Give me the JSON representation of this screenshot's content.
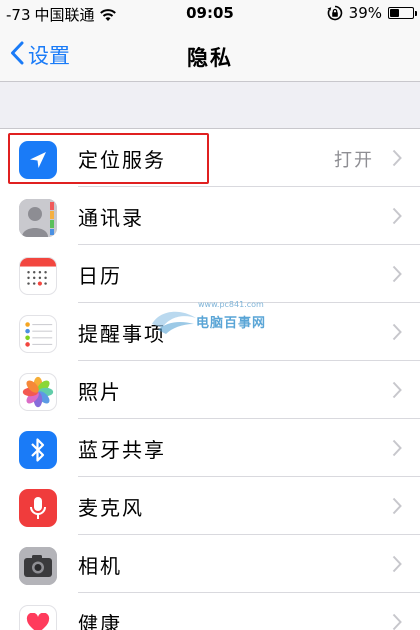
{
  "status_bar": {
    "signal": "-73",
    "carrier": "中国联通",
    "time": "09:05",
    "battery": "39%",
    "battery_level": 0.39
  },
  "nav": {
    "back_label": "设置",
    "title": "隐私"
  },
  "rows": [
    {
      "label": "定位服务",
      "value": "打开",
      "icon": "location-arrow-icon",
      "color": "#1a7bf7"
    },
    {
      "label": "通讯录",
      "value": "",
      "icon": "contacts-icon",
      "color": "#9a9a9f"
    },
    {
      "label": "日历",
      "value": "",
      "icon": "calendar-icon",
      "color": "#ffffff"
    },
    {
      "label": "提醒事项",
      "value": "",
      "icon": "reminders-icon",
      "color": "#ffffff"
    },
    {
      "label": "照片",
      "value": "",
      "icon": "photos-icon",
      "color": "#ffffff"
    },
    {
      "label": "蓝牙共享",
      "value": "",
      "icon": "bluetooth-icon",
      "color": "#1a7bf7"
    },
    {
      "label": "麦克风",
      "value": "",
      "icon": "microphone-icon",
      "color": "#f03c3c"
    },
    {
      "label": "相机",
      "value": "",
      "icon": "camera-icon",
      "color": "#9a9a9f"
    },
    {
      "label": "健康",
      "value": "",
      "icon": "health-icon",
      "color": "#ffffff"
    }
  ],
  "watermark": {
    "url": "www.pc841.com",
    "text": "电脑百事网"
  }
}
